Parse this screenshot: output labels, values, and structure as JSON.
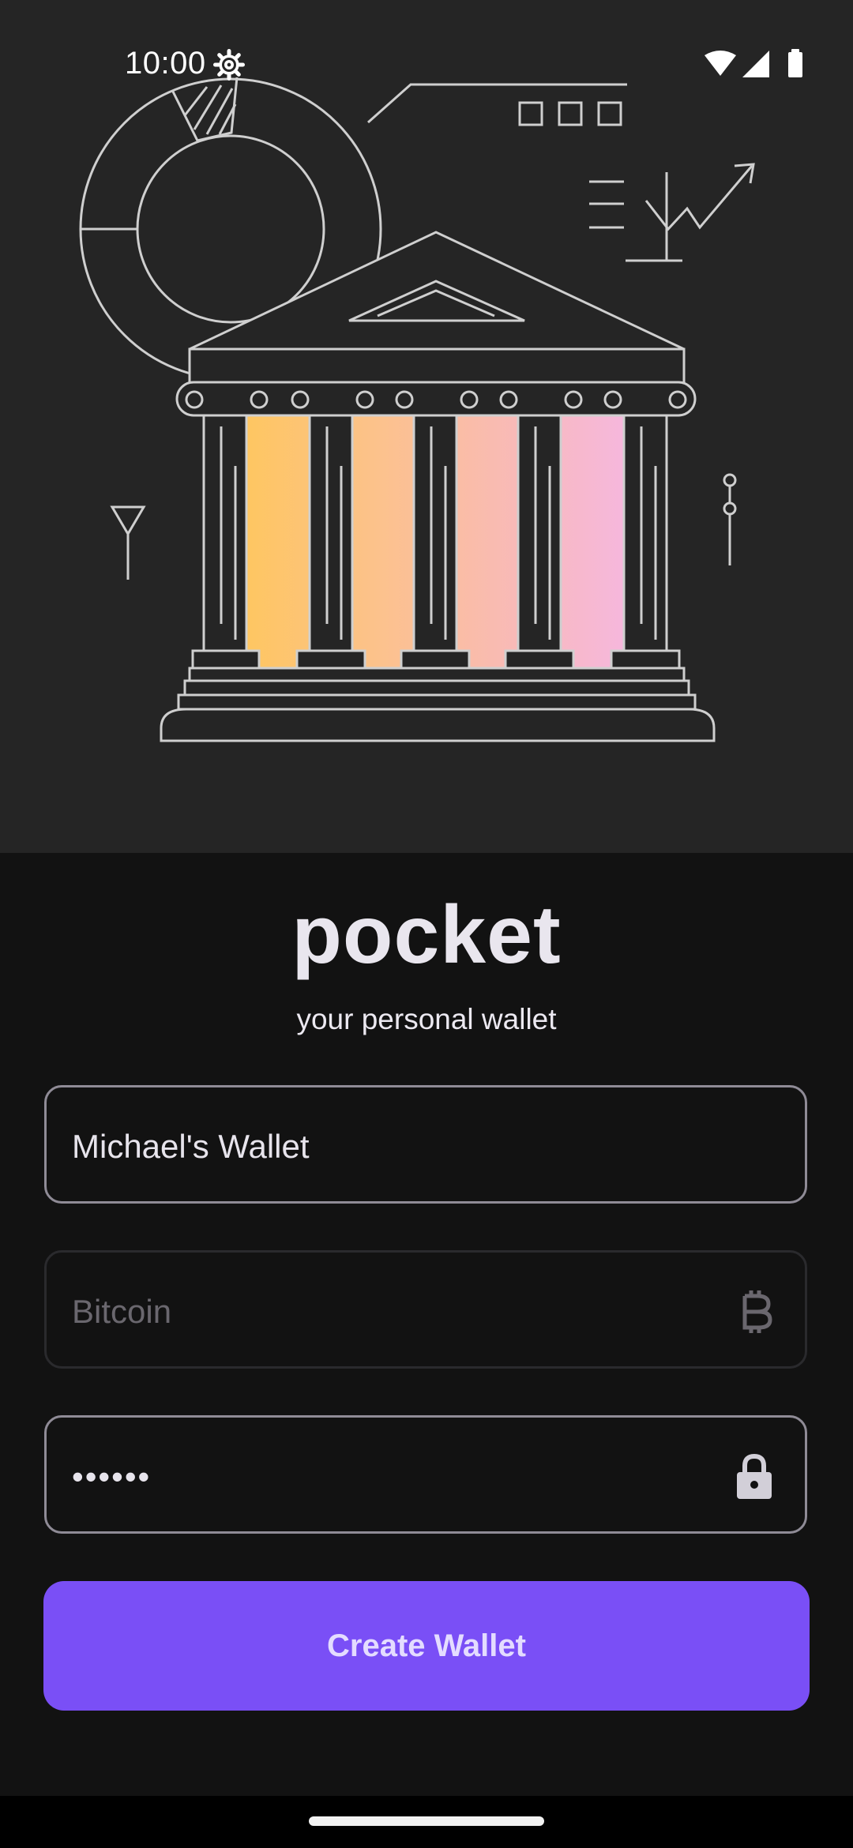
{
  "status_bar": {
    "time": "10:00",
    "icons": [
      "settings-icon",
      "wifi-icon",
      "cellular-signal-icon",
      "battery-icon"
    ]
  },
  "hero": {
    "illustration": "bank-building-illustration",
    "column_colors": [
      "#FEC661",
      "#FCC28C",
      "#F9BBB0",
      "#F6B7DD"
    ],
    "line_color": "#cfcfcf"
  },
  "brand": {
    "title": "pocket",
    "tagline": "your personal wallet"
  },
  "form": {
    "wallet_name": {
      "value": "Michael's Wallet"
    },
    "currency": {
      "placeholder": "Bitcoin",
      "icon": "bitcoin-icon"
    },
    "password": {
      "value": "••••••",
      "icon": "lock-icon"
    },
    "submit_label": "Create Wallet"
  },
  "colors": {
    "accent": "#7A4FF6",
    "background": "#121212",
    "hero_background": "#252525"
  }
}
